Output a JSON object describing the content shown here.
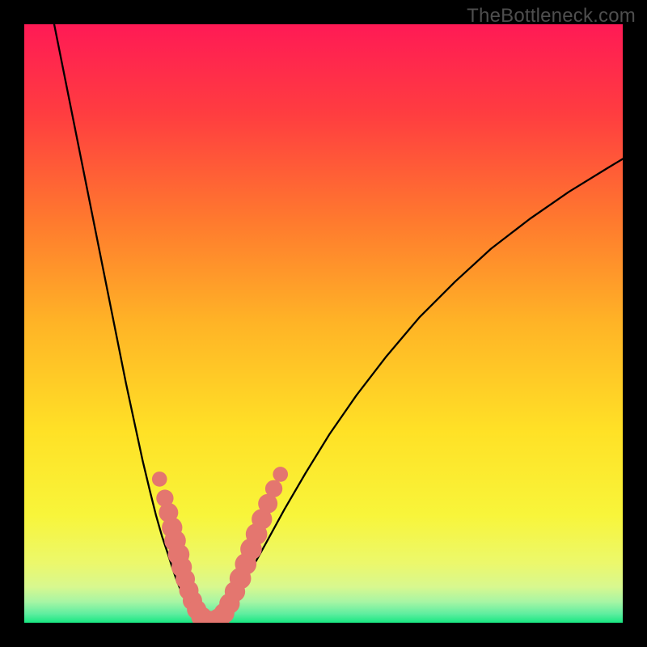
{
  "watermark": "TheBottleneck.com",
  "chart_data": {
    "type": "line",
    "title": "",
    "xlabel": "",
    "ylabel": "",
    "xlim": [
      0,
      100
    ],
    "ylim": [
      0,
      100
    ],
    "grid": false,
    "legend": false,
    "axes_visible": false,
    "background_gradient_stops": [
      {
        "offset": 0.0,
        "color": "#ff1a55"
      },
      {
        "offset": 0.15,
        "color": "#ff3d40"
      },
      {
        "offset": 0.33,
        "color": "#ff7a2e"
      },
      {
        "offset": 0.5,
        "color": "#ffb426"
      },
      {
        "offset": 0.68,
        "color": "#ffe126"
      },
      {
        "offset": 0.82,
        "color": "#f8f53a"
      },
      {
        "offset": 0.9,
        "color": "#ecf86b"
      },
      {
        "offset": 0.94,
        "color": "#d8f88f"
      },
      {
        "offset": 0.965,
        "color": "#a7f5a4"
      },
      {
        "offset": 0.985,
        "color": "#5feea0"
      },
      {
        "offset": 1.0,
        "color": "#18e781"
      }
    ],
    "series": [
      {
        "name": "left-branch",
        "stroke": "#000000",
        "x": [
          5.0,
          6.5,
          8.0,
          9.5,
          11.0,
          12.5,
          14.0,
          15.5,
          17.0,
          18.5,
          19.8,
          21.0,
          22.0,
          23.0,
          24.0,
          24.8,
          25.5,
          26.2,
          27.0,
          27.8,
          28.6
        ],
        "y": [
          100,
          92.5,
          85.0,
          77.5,
          70.0,
          62.5,
          55.0,
          47.5,
          40.0,
          33.0,
          27.0,
          22.0,
          18.0,
          14.5,
          11.5,
          9.0,
          7.0,
          5.3,
          3.8,
          2.4,
          1.2
        ]
      },
      {
        "name": "trough",
        "stroke": "#000000",
        "x": [
          28.6,
          29.5,
          30.5,
          31.5,
          32.5,
          33.5
        ],
        "y": [
          1.2,
          0.4,
          0.1,
          0.1,
          0.4,
          1.2
        ]
      },
      {
        "name": "right-branch",
        "stroke": "#000000",
        "x": [
          33.5,
          34.5,
          36.0,
          38.0,
          40.5,
          43.5,
          47.0,
          51.0,
          55.5,
          60.5,
          66.0,
          72.0,
          78.0,
          84.5,
          91.0,
          97.5,
          100.0
        ],
        "y": [
          1.2,
          3.0,
          5.5,
          9.0,
          13.5,
          19.0,
          25.0,
          31.5,
          38.0,
          44.5,
          51.0,
          57.0,
          62.5,
          67.5,
          72.0,
          76.0,
          77.5
        ]
      }
    ],
    "markers": {
      "name": "highlighted-points",
      "fill": "#e4766f",
      "points": [
        {
          "x": 22.6,
          "y": 24.0,
          "r": 1.1
        },
        {
          "x": 23.5,
          "y": 20.8,
          "r": 1.3
        },
        {
          "x": 24.1,
          "y": 18.4,
          "r": 1.5
        },
        {
          "x": 24.7,
          "y": 15.9,
          "r": 1.6
        },
        {
          "x": 25.2,
          "y": 13.7,
          "r": 1.7
        },
        {
          "x": 25.8,
          "y": 11.4,
          "r": 1.7
        },
        {
          "x": 26.3,
          "y": 9.3,
          "r": 1.6
        },
        {
          "x": 26.9,
          "y": 7.3,
          "r": 1.5
        },
        {
          "x": 27.5,
          "y": 5.4,
          "r": 1.5
        },
        {
          "x": 28.1,
          "y": 3.7,
          "r": 1.5
        },
        {
          "x": 28.8,
          "y": 2.2,
          "r": 1.5
        },
        {
          "x": 29.6,
          "y": 1.0,
          "r": 1.6
        },
        {
          "x": 30.5,
          "y": 0.3,
          "r": 1.7
        },
        {
          "x": 31.5,
          "y": 0.2,
          "r": 1.7
        },
        {
          "x": 32.5,
          "y": 0.6,
          "r": 1.7
        },
        {
          "x": 33.4,
          "y": 1.6,
          "r": 1.6
        },
        {
          "x": 34.3,
          "y": 3.2,
          "r": 1.6
        },
        {
          "x": 35.2,
          "y": 5.2,
          "r": 1.6
        },
        {
          "x": 36.1,
          "y": 7.4,
          "r": 1.7
        },
        {
          "x": 37.0,
          "y": 9.8,
          "r": 1.7
        },
        {
          "x": 37.9,
          "y": 12.3,
          "r": 1.7
        },
        {
          "x": 38.8,
          "y": 14.8,
          "r": 1.7
        },
        {
          "x": 39.7,
          "y": 17.3,
          "r": 1.6
        },
        {
          "x": 40.7,
          "y": 19.9,
          "r": 1.5
        },
        {
          "x": 41.7,
          "y": 22.4,
          "r": 1.3
        },
        {
          "x": 42.8,
          "y": 24.8,
          "r": 1.1
        }
      ]
    }
  }
}
